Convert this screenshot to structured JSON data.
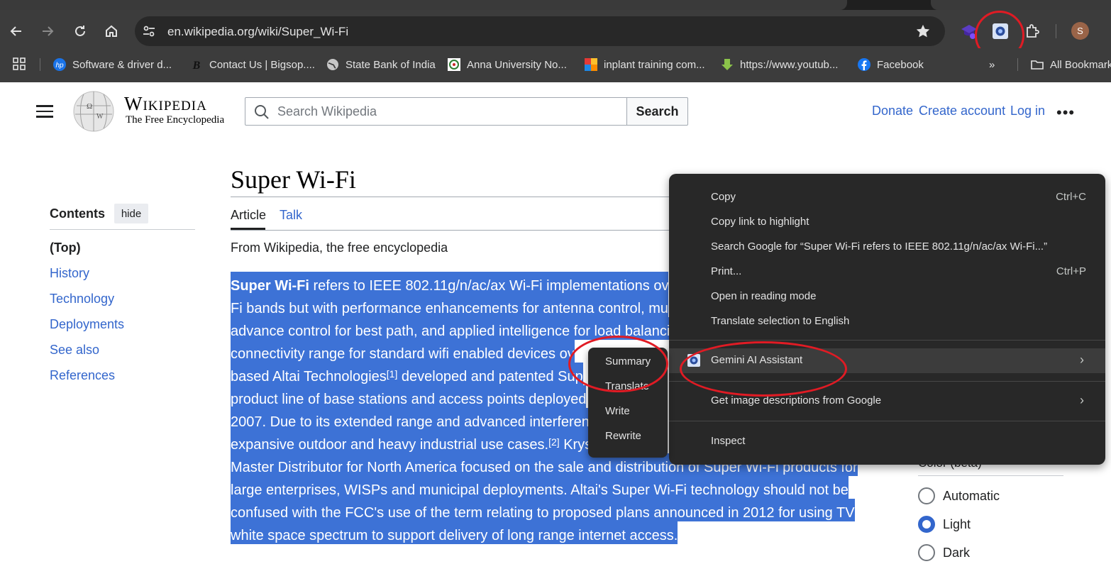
{
  "browser": {
    "url": "en.wikipedia.org/wiki/Super_Wi-Fi",
    "profile_initial": "S",
    "bookmarks": [
      {
        "label": "Software & driver d...",
        "icon": "hp-logo-icon"
      },
      {
        "label": "Contact Us | Bigsop....",
        "icon": "bigsop-logo-icon"
      },
      {
        "label": "State Bank of India",
        "icon": "globe-icon"
      },
      {
        "label": "Anna University No...",
        "icon": "anna-university-logo-icon"
      },
      {
        "label": "inplant training com...",
        "icon": "colorful-grid-icon"
      },
      {
        "label": "https://www.youtub...",
        "icon": "green-arrow-icon"
      },
      {
        "label": "Facebook",
        "icon": "facebook-icon"
      }
    ],
    "all_bookmarks_label": "All Bookmarks"
  },
  "wiki": {
    "logo_title": "Wikipedia",
    "logo_subtitle": "The Free Encyclopedia",
    "search_placeholder": "Search Wikipedia",
    "search_button": "Search",
    "donate": "Donate",
    "create_account": "Create account",
    "log_in": "Log in",
    "toc": {
      "title": "Contents",
      "hide": "hide",
      "items": [
        "(Top)",
        "History",
        "Technology",
        "Deployments",
        "See also",
        "References"
      ]
    },
    "article": {
      "title": "Super Wi-Fi",
      "tab_article": "Article",
      "tab_talk": "Talk",
      "from": "From Wikipedia, the free encyclopedia",
      "lines": [
        {
          "bold": "Super Wi-Fi",
          "text": " refers to IEEE 802.11g/n/ac/ax Wi-Fi implementations ov"
        },
        {
          "text": "Fi bands but with performance enhancements for antenna control, mu"
        },
        {
          "text": "advance control for best path, and applied intelligence for load balanci"
        },
        {
          "text": "connectivity range for standard wifi enabled devices ov"
        },
        {
          "text": "based Altai Technologies",
          "sup": "[1]",
          "tail": " developed and patented Sup"
        },
        {
          "text": "product line of base stations and access points deployed"
        },
        {
          "text": "2007. Due to its extended range and advanced interferen"
        },
        {
          "text": "expansive outdoor and heavy industrial use cases.",
          "sup": "[2]",
          "tail": " Krys"
        },
        {
          "text": "Master Distributor for North America focused on the sale and distribution of Super Wi-Fi products for"
        },
        {
          "text": "large enterprises, WISPs and municipal deployments. Altai's Super Wi-Fi technology should not be"
        },
        {
          "text": "confused with the FCC's use of the term relating to proposed plans announced in 2012 for using TV"
        },
        {
          "text": "white space spectrum to support delivery of long range internet access."
        }
      ]
    },
    "appearance": {
      "color_label": "Color (beta)",
      "options": [
        "Automatic",
        "Light",
        "Dark"
      ],
      "selected": "Light"
    }
  },
  "context_menu": {
    "items": [
      {
        "label": "Copy",
        "shortcut": "Ctrl+C"
      },
      {
        "label": "Copy link to highlight"
      },
      {
        "label": "Search Google for “Super Wi-Fi refers to IEEE 802.11g/n/ac/ax Wi-Fi...”"
      },
      {
        "label": "Print...",
        "shortcut": "Ctrl+P"
      },
      {
        "label": "Open in reading mode"
      },
      {
        "label": "Translate selection to English"
      }
    ],
    "gemini": "Gemini AI Assistant",
    "image_descriptions": "Get image descriptions from Google",
    "inspect": "Inspect",
    "submenu": [
      "Summary",
      "Translate",
      "Write",
      "Rewrite"
    ]
  },
  "colors": {
    "selection": "#3d72d6",
    "link": "#3366cc",
    "annotation_ring": "#e01b24",
    "menu_bg": "#282828"
  }
}
